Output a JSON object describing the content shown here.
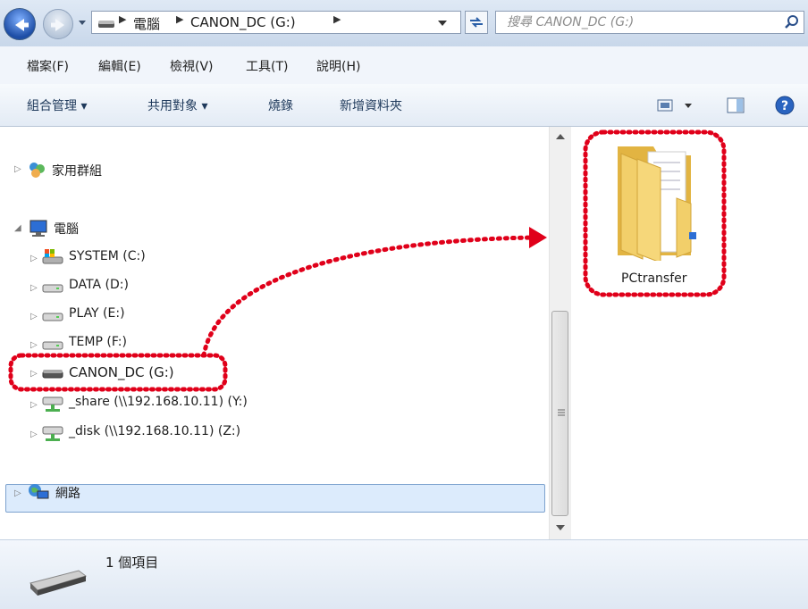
{
  "address_bar": {
    "crumbs": [
      "電腦",
      "CANON_DC (G:)"
    ],
    "search_placeholder": "搜尋 CANON_DC (G:)"
  },
  "menu": [
    "檔案(F)",
    "編輯(E)",
    "檢視(V)",
    "工具(T)",
    "說明(H)"
  ],
  "commands": {
    "organize": "組合管理 ▾",
    "share": "共用對象 ▾",
    "burn": "燒錄",
    "new_folder": "新增資料夾"
  },
  "nav": {
    "homegroup": "家用群組",
    "computer": "電腦",
    "drives": [
      "SYSTEM (C:)",
      "DATA (D:)",
      "PLAY (E:)",
      "TEMP (F:)",
      "CANON_DC (G:)",
      "_share (\\\\192.168.10.11) (Y:)",
      "_disk (\\\\192.168.10.11) (Z:)"
    ],
    "network": "網路",
    "selected": "CANON_DC (G:)"
  },
  "content": {
    "folder_name": "PCtransfer"
  },
  "details": {
    "item_count": "1 個項目"
  },
  "colors": {
    "highlight_dotted": "#e0001a",
    "selection_bg": "#dcebfc",
    "selection_border": "#7da2ce",
    "folder": "#f2c94c"
  },
  "icons": [
    "back-arrow-icon",
    "forward-arrow-icon",
    "drive-icon",
    "search-icon",
    "refresh-icon",
    "homegroup-icon",
    "computer-icon",
    "network-icon",
    "network-drive-icon",
    "folder-icon",
    "help-icon",
    "preview-pane-icon",
    "view-icon"
  ]
}
